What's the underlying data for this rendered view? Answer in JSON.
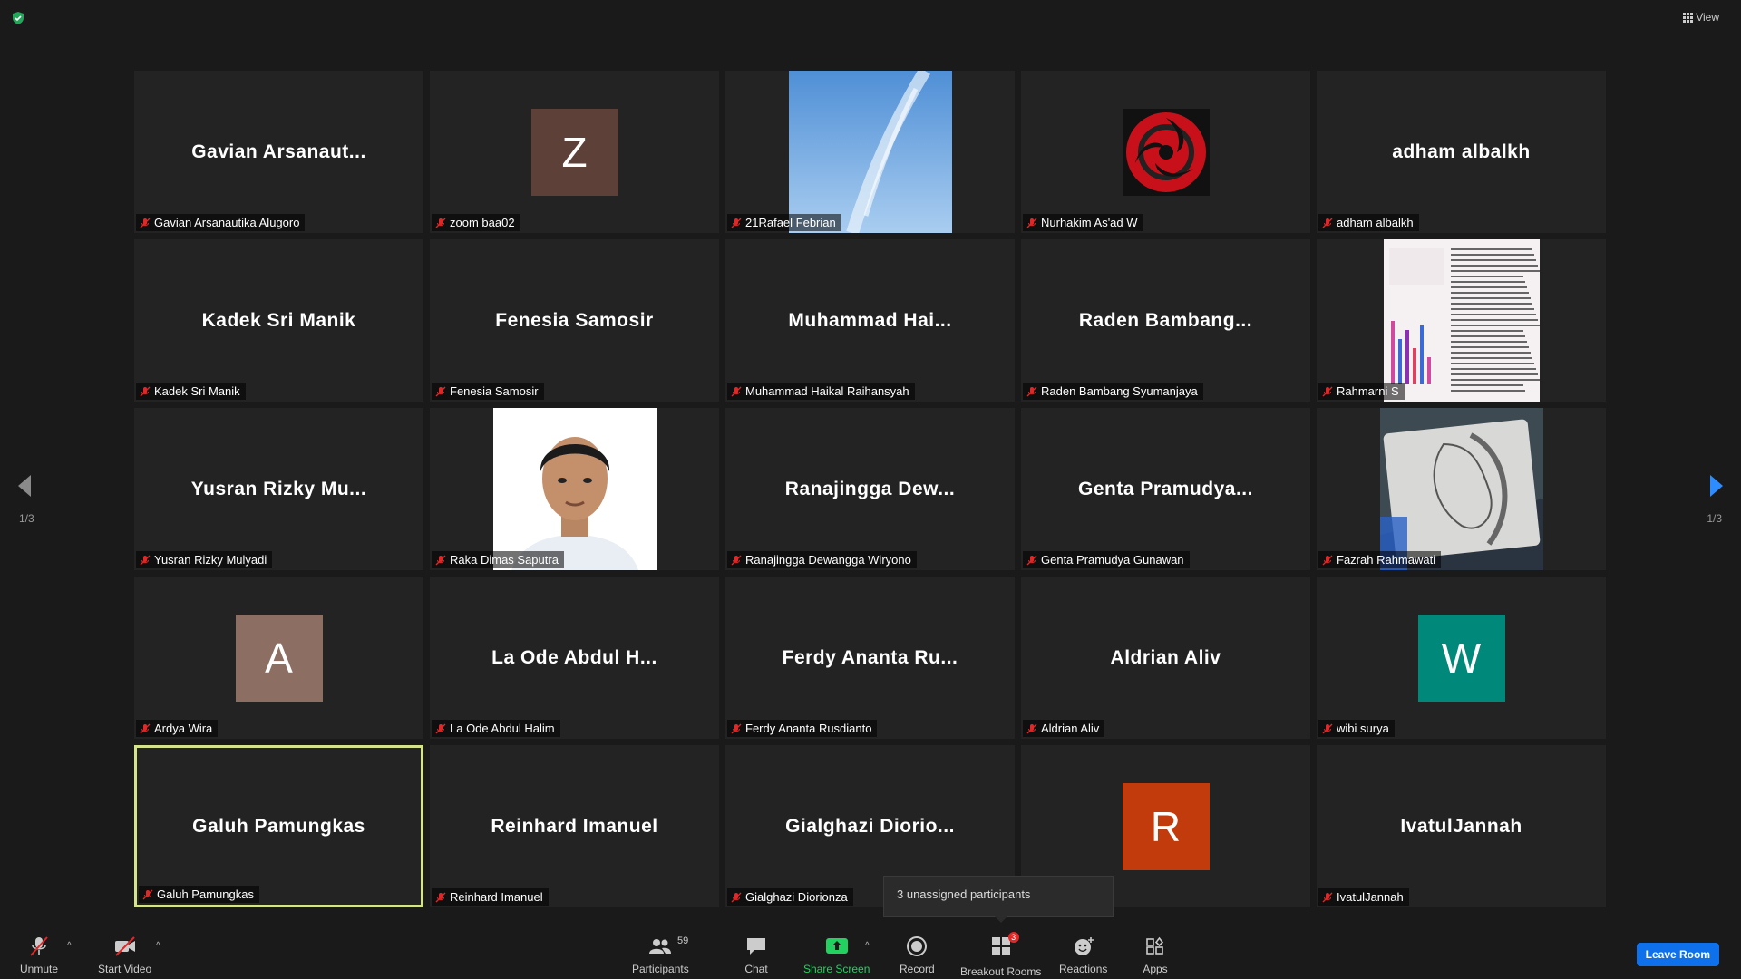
{
  "header": {
    "view_label": "View"
  },
  "pagination": {
    "left": "1/3",
    "right": "1/3"
  },
  "tiles": [
    {
      "display": "Gavian  Arsanaut...",
      "label": "Gavian Arsanautika Alugoro",
      "type": "name"
    },
    {
      "display": "Z",
      "label": "zoom baa02",
      "type": "avatar",
      "color": "#5d4037"
    },
    {
      "display": "",
      "label": "21Rafael Febrian",
      "type": "photo-sky"
    },
    {
      "display": "",
      "label": "Nurhakim As'ad W",
      "type": "photo-eye"
    },
    {
      "display": "adham albalkh",
      "label": "adham albalkh",
      "type": "name"
    },
    {
      "display": "Kadek Sri Manik",
      "label": "Kadek Sri Manik",
      "type": "name"
    },
    {
      "display": "Fenesia Samosir",
      "label": "Fenesia Samosir",
      "type": "name"
    },
    {
      "display": "Muhammad  Hai...",
      "label": "Muhammad Haikal Raihansyah",
      "type": "name"
    },
    {
      "display": "Raden  Bambang...",
      "label": "Raden Bambang Syumanjaya",
      "type": "name"
    },
    {
      "display": "",
      "label": "Rahmarni S",
      "type": "photo-doc"
    },
    {
      "display": "Yusran  Rizky  Mu...",
      "label": "Yusran Rizky Mulyadi",
      "type": "name"
    },
    {
      "display": "",
      "label": "Raka Dimas Saputra",
      "type": "photo-person"
    },
    {
      "display": "Ranajingga  Dew...",
      "label": "Ranajingga Dewangga Wiryono",
      "type": "name"
    },
    {
      "display": "Genta  Pramudya...",
      "label": "Genta Pramudya Gunawan",
      "type": "name"
    },
    {
      "display": "",
      "label": "Fazrah Rahmawati",
      "type": "photo-sketch"
    },
    {
      "display": "A",
      "label": "Ardya Wira",
      "type": "avatar",
      "color": "#8d6e63"
    },
    {
      "display": "La  Ode  Abdul  H...",
      "label": "La Ode Abdul Halim",
      "type": "name"
    },
    {
      "display": "Ferdy  Ananta  Ru...",
      "label": "Ferdy Ananta Rusdianto",
      "type": "name"
    },
    {
      "display": "Aldrian Aliv",
      "label": "Aldrian Aliv",
      "type": "name"
    },
    {
      "display": "W",
      "label": "wibi surya",
      "type": "avatar",
      "color": "#00897b"
    },
    {
      "display": "Galuh Pamungkas",
      "label": "Galuh Pamungkas",
      "type": "name",
      "active": true
    },
    {
      "display": "Reinhard Imanuel",
      "label": "Reinhard Imanuel",
      "type": "name"
    },
    {
      "display": "Gialghazi  Diorio...",
      "label": "Gialghazi Diorionza",
      "type": "name"
    },
    {
      "display": "R",
      "label": "",
      "type": "avatar",
      "color": "#c23b0c"
    },
    {
      "display": "IvatulJannah",
      "label": "IvatulJannah",
      "type": "name"
    }
  ],
  "tooltip": "3 unassigned participants",
  "toolbar": {
    "unmute": "Unmute",
    "start_video": "Start Video",
    "participants": "Participants",
    "participants_count": "59",
    "chat": "Chat",
    "share_screen": "Share Screen",
    "record": "Record",
    "breakout_rooms": "Breakout Rooms",
    "breakout_badge": "3",
    "reactions": "Reactions",
    "apps": "Apps",
    "leave": "Leave Room"
  }
}
